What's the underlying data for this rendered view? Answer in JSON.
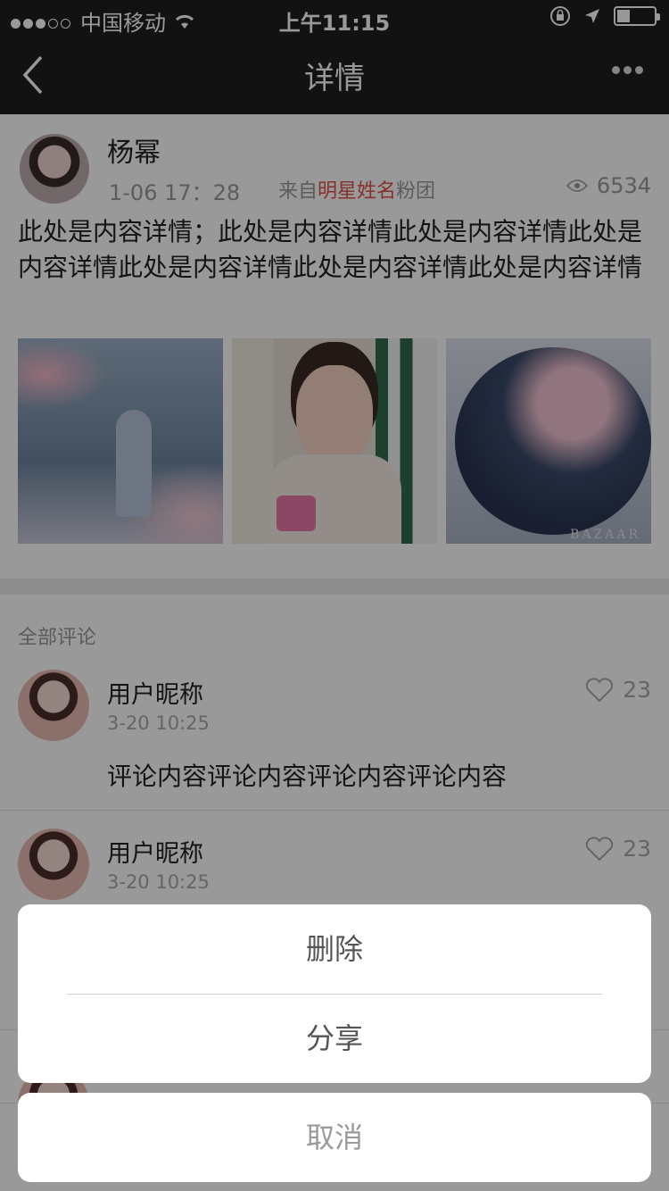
{
  "status_bar": {
    "carrier": "中国移动",
    "time": "上午11:15"
  },
  "nav": {
    "title": "详情"
  },
  "post": {
    "author": "杨幂",
    "time": "1-06 17：28",
    "source_prefix": "来自",
    "source_name": "明星姓名",
    "source_suffix": "粉团",
    "views": "6534",
    "content": "此处是内容详情；此处是内容详情此处是内容详情此处是内容详情此处是内容详情此处是内容详情此处是内容详情",
    "photo_watermark": "BAZAAR"
  },
  "comments": {
    "title": "全部评论",
    "items": [
      {
        "name": "用户昵称",
        "time": "3-20  10:25",
        "likes": "23",
        "text": "评论内容评论内容评论内容评论内容"
      },
      {
        "name": "用户昵称",
        "time": "3-20  10:25",
        "likes": "23",
        "text": ""
      },
      {
        "name": "",
        "time": "",
        "likes": "",
        "text": ""
      }
    ]
  },
  "action_sheet": {
    "delete_label": "删除",
    "share_label": "分享",
    "cancel_label": "取消"
  },
  "colors": {
    "highlight": "#e0504a",
    "navbar": "#1f1f1f"
  }
}
